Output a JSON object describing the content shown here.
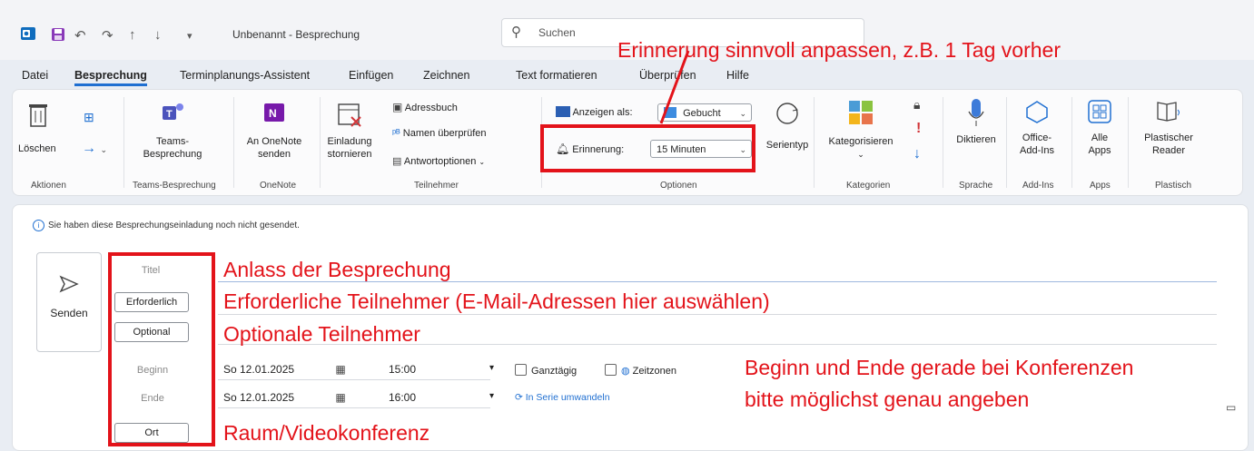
{
  "titlebar": {
    "window_title": "Unbenannt - Besprechung",
    "search_placeholder": "Suchen"
  },
  "menu": {
    "tabs": [
      "Datei",
      "Besprechung",
      "Terminplanungs-Assistent",
      "Einfügen",
      "Zeichnen",
      "Text formatieren",
      "Überprüfen",
      "Hilfe"
    ],
    "active": "Besprechung"
  },
  "ribbon": {
    "aktionen": {
      "delete": "Löschen",
      "group": "Aktionen"
    },
    "teams": {
      "button": "Teams-Besprechung",
      "group": "Teams-Besprechung"
    },
    "onenote": {
      "button": "An OneNote senden",
      "group": "OneNote"
    },
    "teilnehmer": {
      "cancel": "Einladung stornieren",
      "addressbook": "Adressbuch",
      "check_names": "Namen überprüfen",
      "response_options": "Antwortoptionen",
      "group": "Teilnehmer"
    },
    "optionen": {
      "show_as_label": "Anzeigen als:",
      "show_as_value": "Gebucht",
      "reminder_label": "Erinnerung:",
      "reminder_value": "15 Minuten",
      "series_type": "Serientyp",
      "group": "Optionen"
    },
    "kategorien": {
      "button": "Kategorisieren",
      "group": "Kategorien"
    },
    "sprache": {
      "button": "Diktieren",
      "group": "Sprache"
    },
    "addins": {
      "button": "Office-Add-Ins",
      "group": "Add-Ins"
    },
    "apps": {
      "button": "Alle Apps",
      "group": "Apps"
    },
    "plastisch": {
      "button": "Plastischer Reader",
      "group": "Plastisch"
    }
  },
  "form": {
    "info": "Sie haben diese Besprechungseinladung noch nicht gesendet.",
    "send": "Senden",
    "title_label": "Titel",
    "required_button": "Erforderlich",
    "optional_button": "Optional",
    "start_label": "Beginn",
    "end_label": "Ende",
    "start_date": "So 12.01.2025",
    "start_time": "15:00",
    "end_date": "So 12.01.2025",
    "end_time": "16:00",
    "all_day": "Ganztägig",
    "time_zones": "Zeitzonen",
    "make_recurring": "In Serie umwandeln",
    "location_button": "Ort"
  },
  "annotations": {
    "reminder": "Erinnerung sinnvoll anpassen, z.B. 1 Tag vorher",
    "title": "Anlass der Besprechung",
    "required": "Erforderliche Teilnehmer (E-Mail-Adressen hier auswählen)",
    "optional": "Optionale Teilnehmer",
    "time_line1": "Beginn und Ende gerade bei Konferenzen",
    "time_line2": "bitte möglichst genau angeben",
    "location": "Raum/Videokonferenz"
  },
  "colors": {
    "annotation": "#e3131a",
    "accent": "#1f6fd1"
  }
}
